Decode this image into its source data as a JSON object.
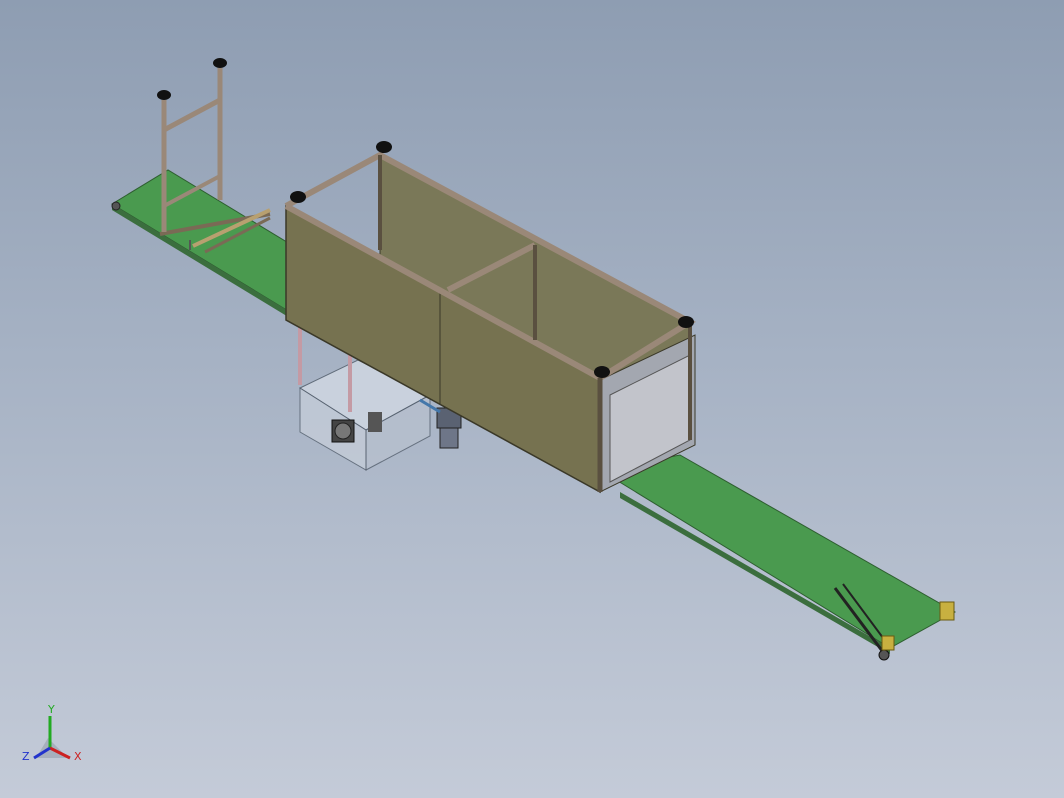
{
  "viewport": {
    "background_top": "#8e9db2",
    "background_bottom": "#c4cbd8"
  },
  "model": {
    "conveyor_belt_color": "#4a9a4f",
    "frame_color": "#9a8878",
    "panel_color": "#7a7858",
    "glass_box_color": "#cfd7e2"
  },
  "triad": {
    "y_label": "Y",
    "x_label": "X",
    "z_label": "Z",
    "y_color": "#22aa22",
    "x_color": "#cc2222",
    "z_color": "#2233cc"
  }
}
